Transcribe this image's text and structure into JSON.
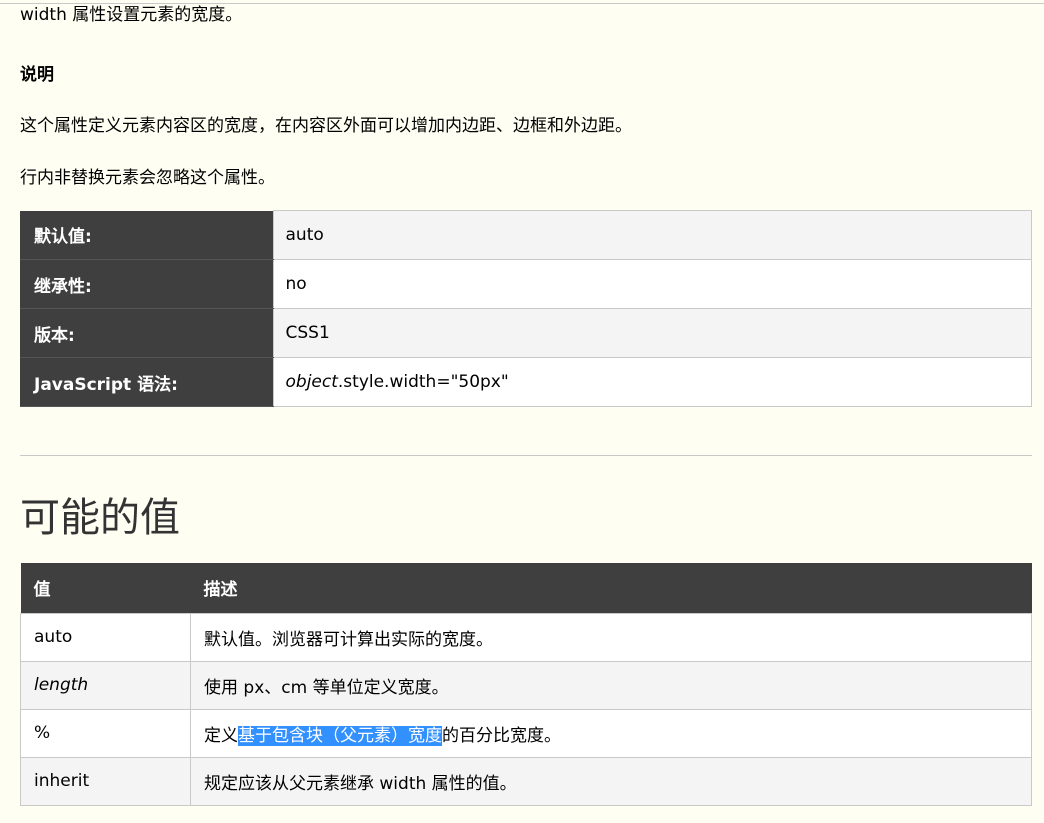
{
  "intro": "width 属性设置元素的宽度。",
  "explanation": {
    "label": "说明",
    "paragraph1": "这个属性定义元素内容区的宽度，在内容区外面可以增加内边距、边框和外边距。",
    "paragraph2": "行内非替换元素会忽略这个属性。"
  },
  "properties": [
    {
      "label": "默认值:",
      "value": "auto"
    },
    {
      "label": "继承性:",
      "value": "no"
    },
    {
      "label": "版本:",
      "value": "CSS1"
    },
    {
      "label": "JavaScript 语法:",
      "value_italic": "object",
      "value_rest": ".style.width=\"50px\""
    }
  ],
  "possible_values": {
    "heading": "可能的值",
    "headers": [
      "值",
      "描述"
    ],
    "rows": [
      {
        "value": "auto",
        "desc": "默认值。浏览器可计算出实际的宽度。"
      },
      {
        "value": "length",
        "desc": "使用 px、cm 等单位定义宽度。"
      },
      {
        "value": "%",
        "desc_before": "定义",
        "desc_selected": "基于包含块（父元素）宽度",
        "desc_after": "的百分比宽度。"
      },
      {
        "value": "inherit",
        "desc": "规定应该从父元素继承 width 属性的值。"
      }
    ]
  },
  "colors": {
    "background": "#fefef3",
    "header_bg": "#3f3f3f",
    "selection": "#3390ff"
  }
}
